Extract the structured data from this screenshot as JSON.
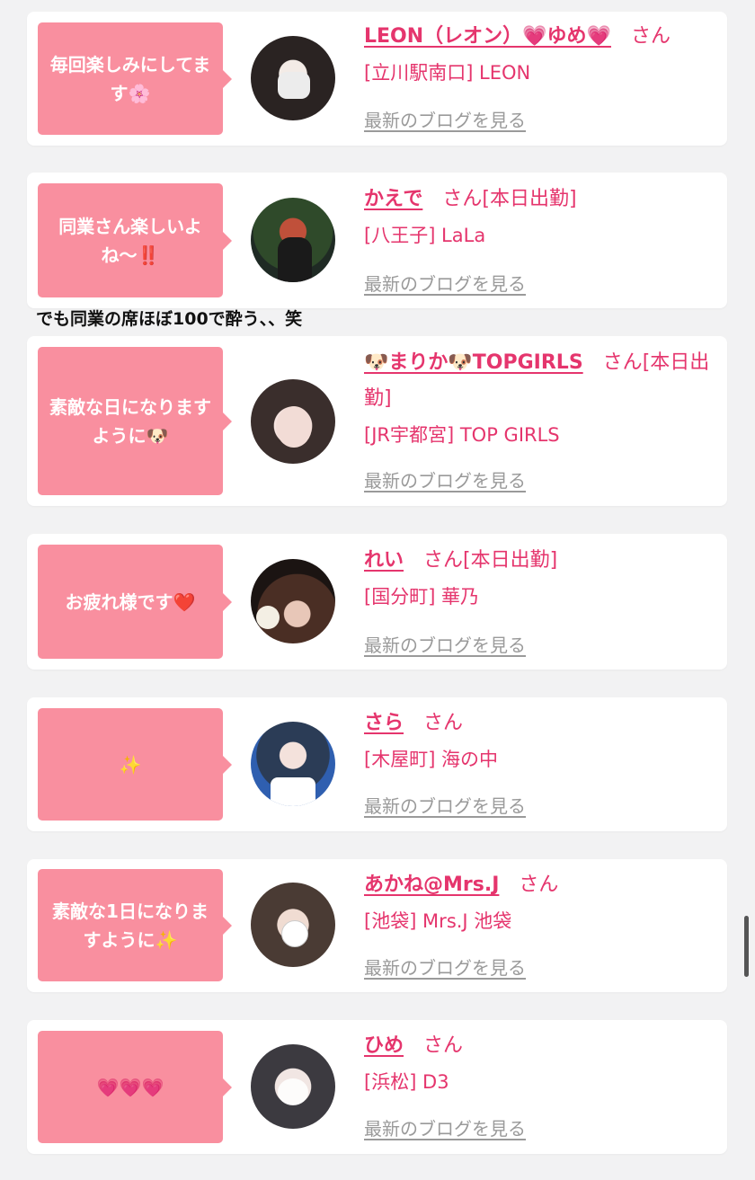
{
  "entries": [
    {
      "message": "毎回楽しみにしてます🌸",
      "name": "LEON（レオン）💗ゆめ💗",
      "suffix": "さん",
      "status": "",
      "shop": "[立川駅南口] LEON",
      "blog_link": "最新のブログを見る"
    },
    {
      "message": "同業さん楽しいよね〜‼️",
      "name": "かえで",
      "suffix": "さん",
      "status": "[本日出勤]",
      "shop": "[八王子] LaLa",
      "blog_link": "最新のブログを見る"
    },
    {
      "message": "素敵な日になりますように🐶",
      "name": "🐶まりか🐶TOPGIRLS",
      "suffix": "さん",
      "status": "[本日出勤]",
      "shop": "[JR宇都宮] TOP GIRLS",
      "blog_link": "最新のブログを見る"
    },
    {
      "message": "お疲れ様です❤️",
      "name": "れい",
      "suffix": "さん",
      "status": "[本日出勤]",
      "shop": "[国分町] 華乃",
      "blog_link": "最新のブログを見る"
    },
    {
      "message": "✨",
      "name": "さら",
      "suffix": "さん",
      "status": "",
      "shop": "[木屋町] 海の中",
      "blog_link": "最新のブログを見る"
    },
    {
      "message": "素敵な1日になりますように✨",
      "name": "あかね@Mrs.J",
      "suffix": "さん",
      "status": "",
      "shop": "[池袋] Mrs.J 池袋",
      "blog_link": "最新のブログを見る"
    },
    {
      "message": "💗💗💗",
      "name": "ひめ",
      "suffix": "さん",
      "status": "",
      "shop": "[浜松] D3",
      "blog_link": "最新のブログを見る"
    }
  ],
  "overlay_note": "でも同業の席ほぼ100で酔う、、笑",
  "colors": {
    "accent": "#e5356d",
    "bubble": "#f98f9f",
    "link_gray": "#9a9a9a",
    "background": "#f2f2f3"
  }
}
